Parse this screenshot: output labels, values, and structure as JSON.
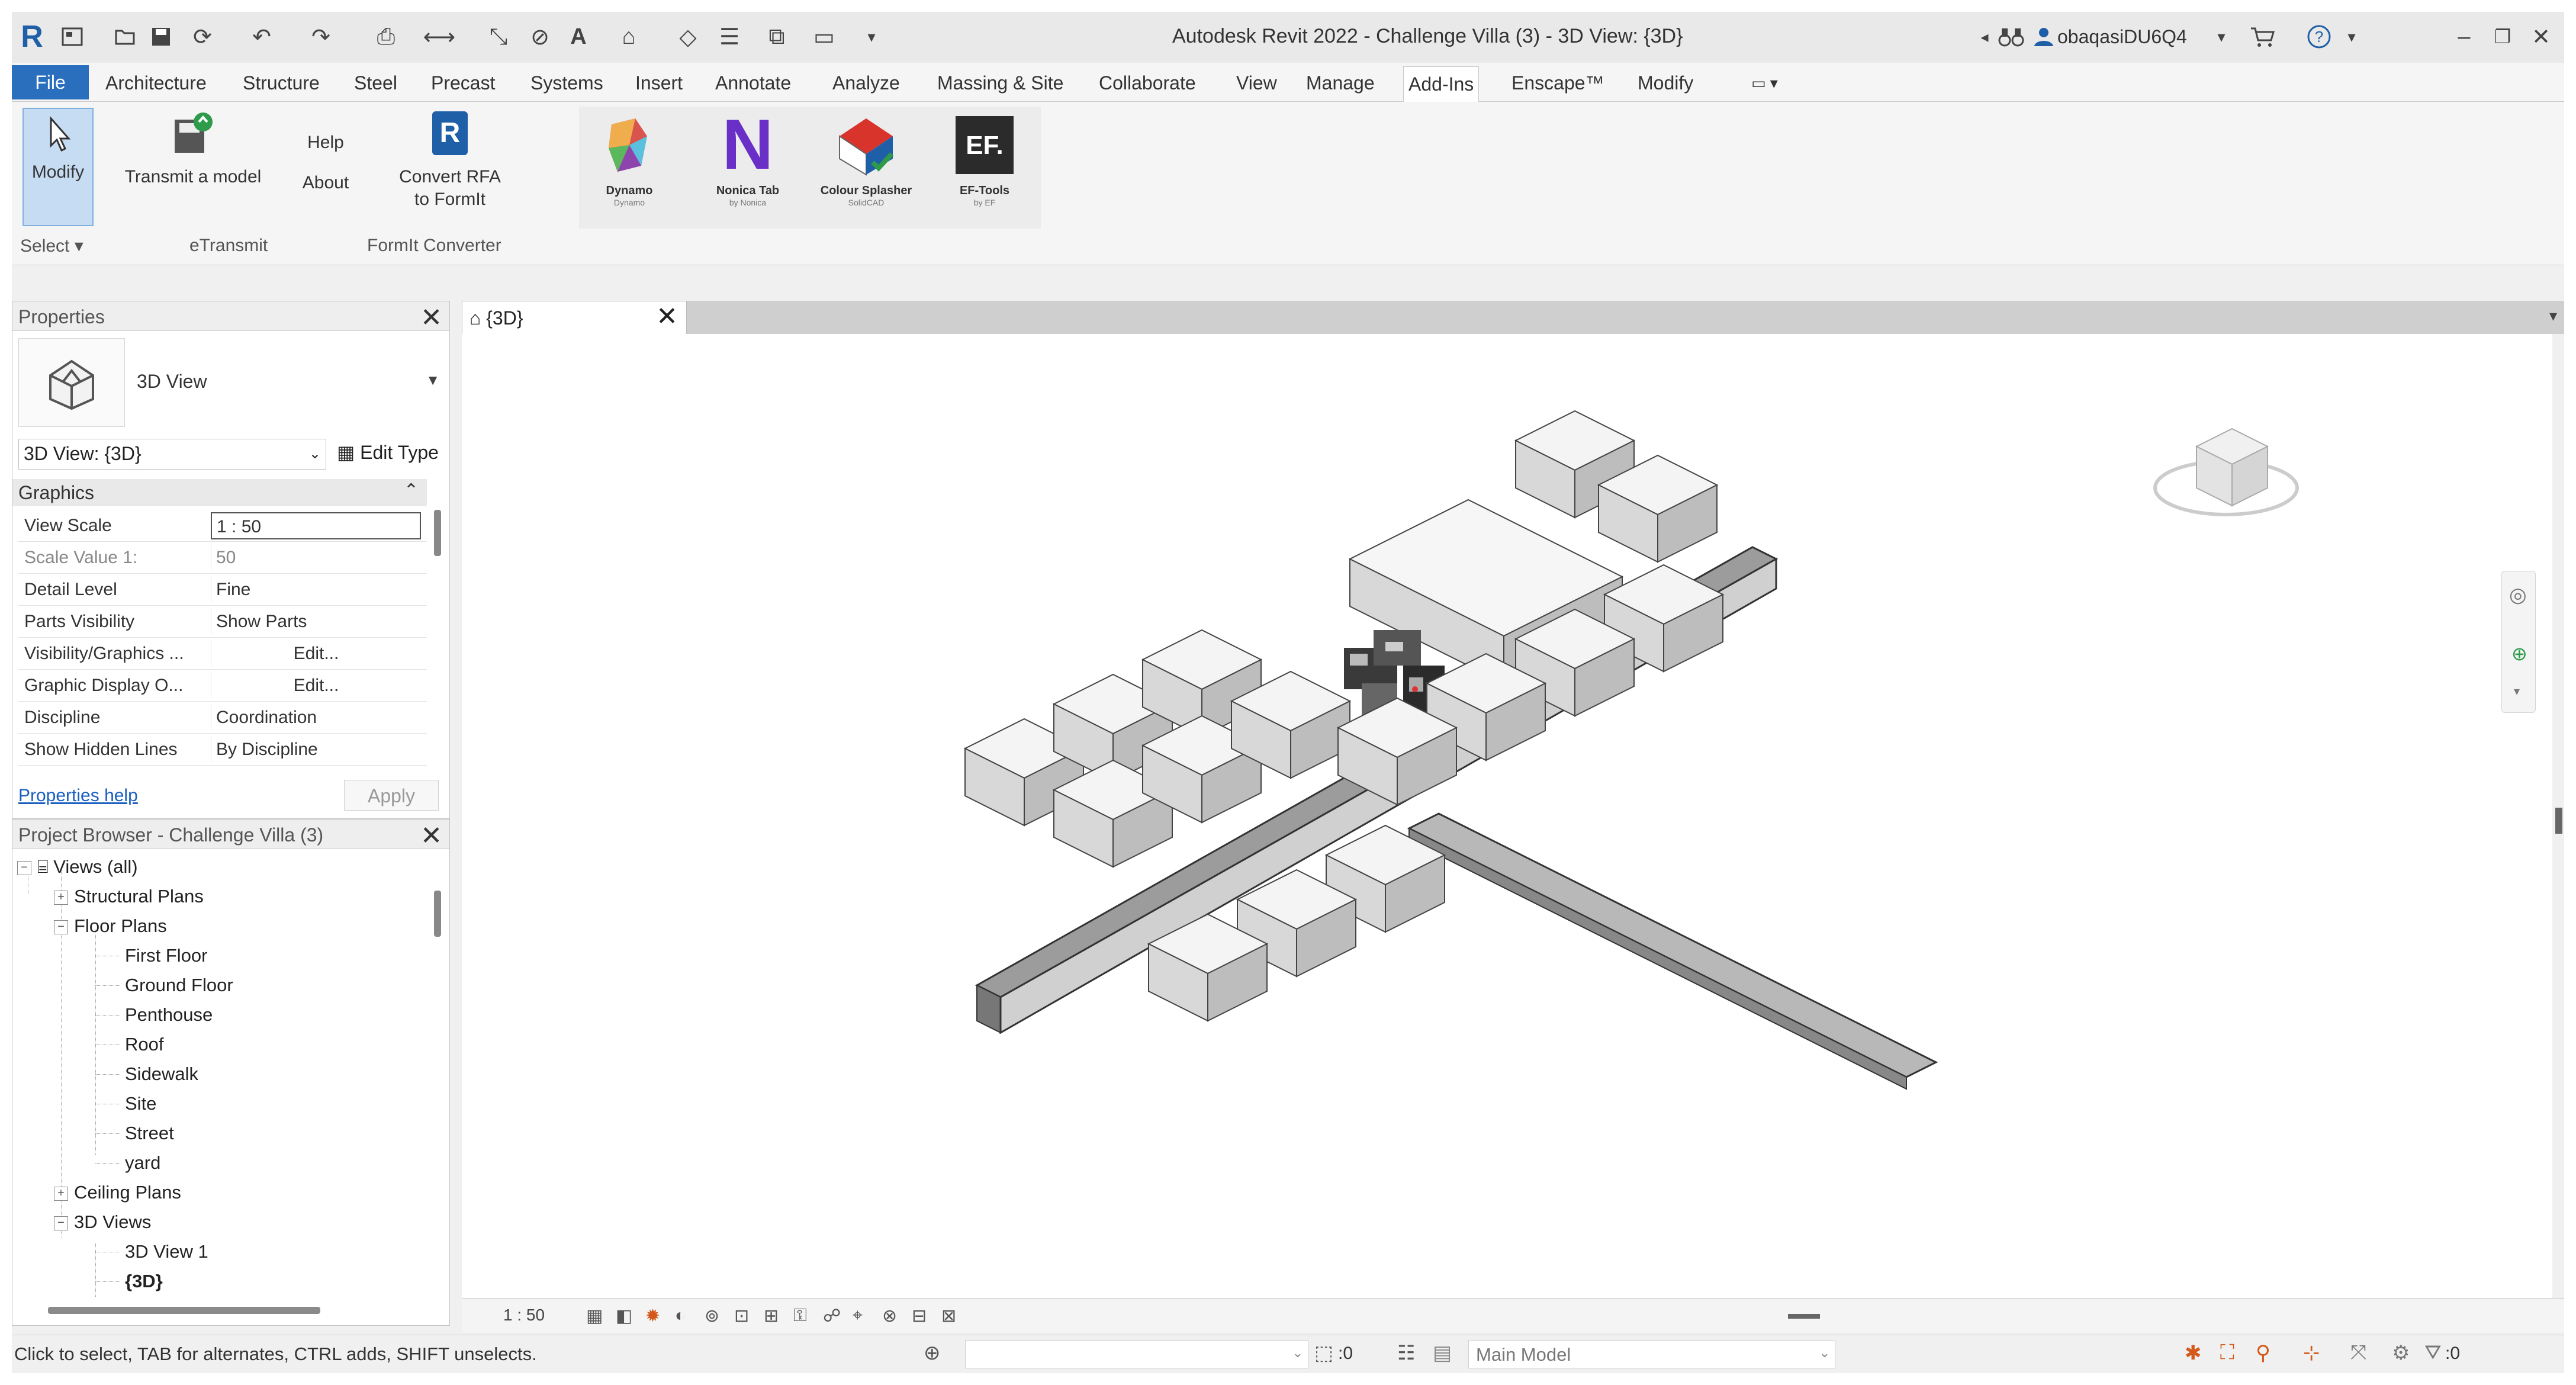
{
  "titlebar": {
    "window_title": "Autodesk Revit 2022 - Challenge Villa (3) - 3D View: {3D}",
    "user": "obaqasiDU6Q4"
  },
  "ribbon_tabs": [
    "Architecture",
    "Structure",
    "Steel",
    "Precast",
    "Systems",
    "Insert",
    "Annotate",
    "Analyze",
    "Massing & Site",
    "Collaborate",
    "View",
    "Manage",
    "Add-Ins",
    "Enscape™",
    "Modify"
  ],
  "file_tab": "File",
  "active_tab": "Add-Ins",
  "ribbon": {
    "modify": "Modify",
    "select": "Select",
    "transmit": "Transmit a model",
    "etransmit_panel": "eTransmit",
    "help": "Help",
    "about": "About",
    "convert_line1": "Convert RFA",
    "convert_line2": "to FormIt",
    "formit_panel": "FormIt Converter",
    "addins": [
      {
        "label": "Dynamo",
        "sub": "Dynamo"
      },
      {
        "label": "Nonica Tab",
        "sub": "by Nonica"
      },
      {
        "label": "Colour Splasher",
        "sub": "SolidCAD"
      },
      {
        "label": "EF-Tools",
        "sub": "by EF"
      }
    ]
  },
  "properties": {
    "title": "Properties",
    "type_name": "3D View",
    "view_select": "3D View: {3D}",
    "edit_type": "Edit Type",
    "section": "Graphics",
    "rows": [
      {
        "key": "View Scale",
        "value": "1 : 50"
      },
      {
        "key": "Scale Value    1:",
        "value": "50"
      },
      {
        "key": "Detail Level",
        "value": "Fine"
      },
      {
        "key": "Parts Visibility",
        "value": "Show Parts"
      },
      {
        "key": "Visibility/Graphics ...",
        "value": "Edit..."
      },
      {
        "key": "Graphic Display O...",
        "value": "Edit..."
      },
      {
        "key": "Discipline",
        "value": "Coordination"
      },
      {
        "key": "Show Hidden Lines",
        "value": "By Discipline"
      }
    ],
    "help_link": "Properties help",
    "apply": "Apply"
  },
  "browser": {
    "title": "Project Browser - Challenge Villa (3)",
    "views_all": "Views (all)",
    "structural_plans": "Structural Plans",
    "floor_plans": "Floor Plans",
    "floor_items": [
      "First Floor",
      "Ground Floor",
      "Penthouse",
      "Roof",
      "Sidewalk",
      "Site",
      "Street",
      "yard"
    ],
    "ceiling_plans": "Ceiling Plans",
    "views_3d": "3D Views",
    "view_3d_1": "3D View 1",
    "view_3d_current": "{3D}"
  },
  "view": {
    "tab_label": "{3D}",
    "scale": "1 : 50"
  },
  "status": {
    "hint": "Click to select, TAB for alternates, CTRL adds, SHIFT unselects.",
    "zero": ":0",
    "model": "Main Model",
    "filter_count": ":0"
  },
  "colors": {
    "accent": "#2a6fbd",
    "selected_button": "#c6dcf2",
    "link": "#1a5fc0"
  }
}
